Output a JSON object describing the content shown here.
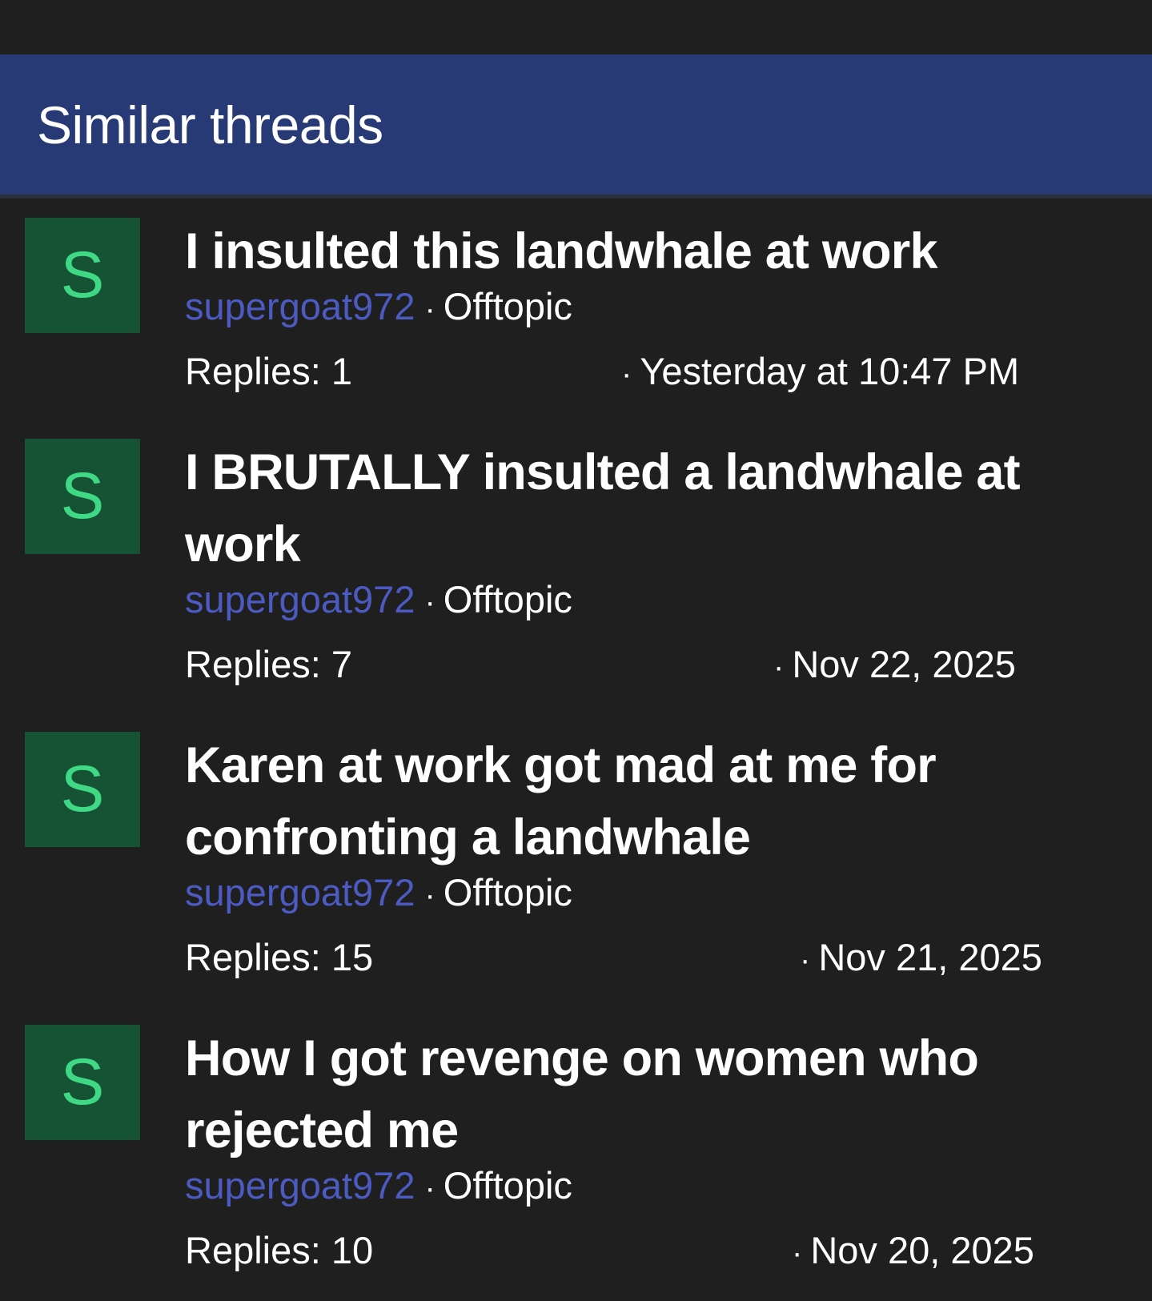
{
  "section": {
    "title": "Similar threads"
  },
  "threads": [
    {
      "avatar_letter": "S",
      "title": "I insulted this landwhale at work",
      "author": "supergoat972",
      "forum": "Offtopic",
      "replies_label": "Replies:",
      "replies": "1",
      "date": "Yesterday at 10:47 PM"
    },
    {
      "avatar_letter": "S",
      "title": "I BRUTALLY insulted a landwhale at work",
      "author": "supergoat972",
      "forum": "Offtopic",
      "replies_label": "Replies:",
      "replies": "7",
      "date": "Nov 22, 2025"
    },
    {
      "avatar_letter": "S",
      "title": "Karen at work got mad at me for confronting a landwhale",
      "author": "supergoat972",
      "forum": "Offtopic",
      "replies_label": "Replies:",
      "replies": "15",
      "date": "Nov 21, 2025"
    },
    {
      "avatar_letter": "S",
      "title": "How I got revenge on women who rejected me",
      "author": "supergoat972",
      "forum": "Offtopic",
      "replies_label": "Replies:",
      "replies": "10",
      "date": "Nov 20, 2025"
    }
  ],
  "separator": "·"
}
